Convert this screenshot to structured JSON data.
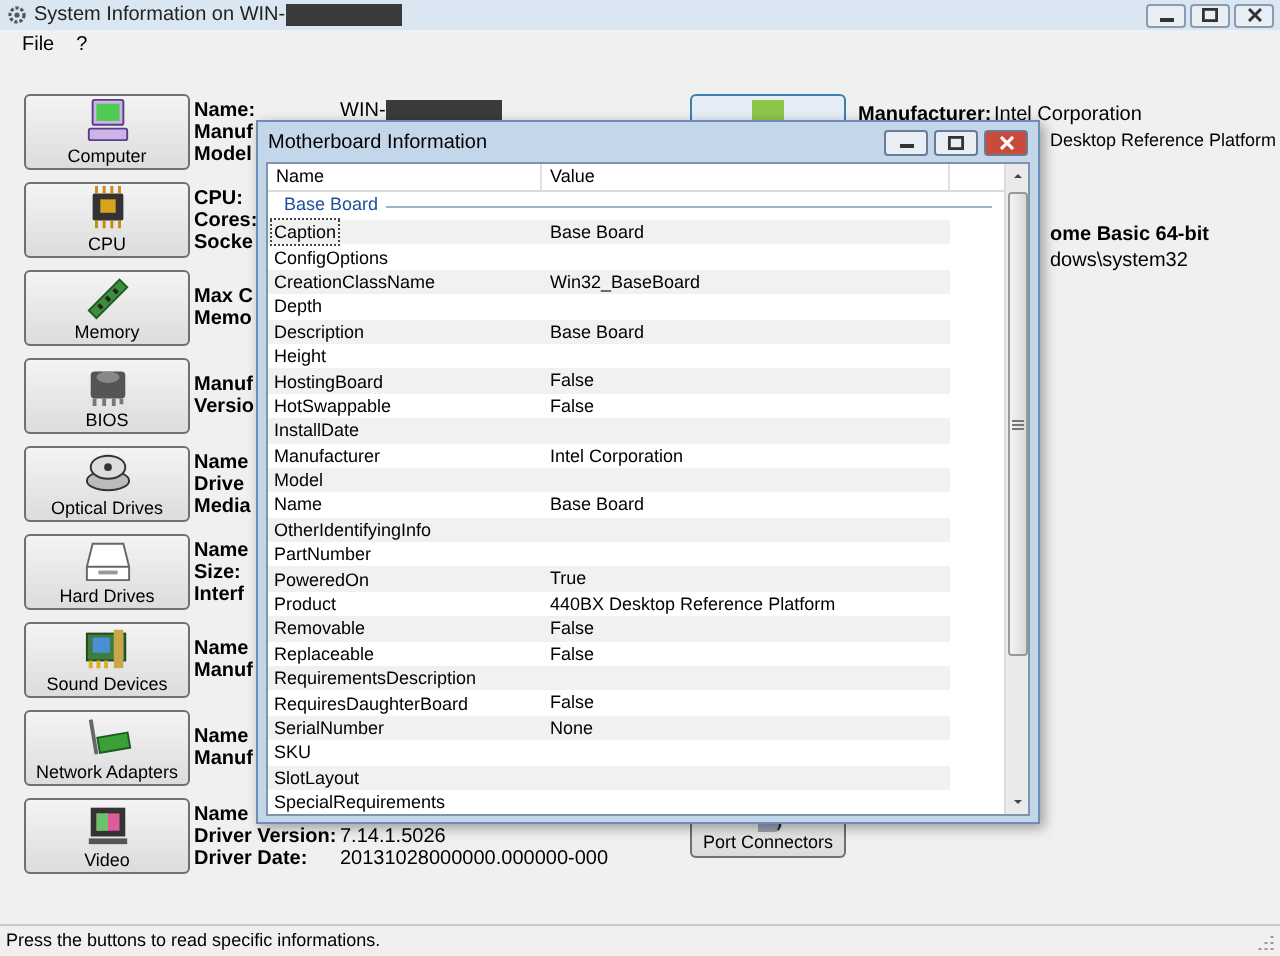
{
  "window": {
    "title": "System Information on WIN-",
    "title_redacted": true
  },
  "menu": [
    "File",
    "?"
  ],
  "categories": [
    {
      "label": "Computer",
      "fields": [
        {
          "label": "Name:",
          "value": "WIN-",
          "redacted": true
        },
        {
          "label": "Manuf"
        },
        {
          "label": "Model"
        }
      ]
    },
    {
      "label": "CPU",
      "fields": [
        {
          "label": "CPU:"
        },
        {
          "label": "Cores:"
        },
        {
          "label": "Socke"
        }
      ]
    },
    {
      "label": "Memory",
      "fields": [
        {
          "label": "Max C"
        },
        {
          "label": "Memo"
        }
      ]
    },
    {
      "label": "BIOS",
      "fields": [
        {
          "label": "Manuf"
        },
        {
          "label": "Versio"
        }
      ]
    },
    {
      "label": "Optical Drives",
      "fields": [
        {
          "label": "Name"
        },
        {
          "label": "Drive"
        },
        {
          "label": "Media"
        }
      ]
    },
    {
      "label": "Hard Drives",
      "fields": [
        {
          "label": "Name"
        },
        {
          "label": "Size:"
        },
        {
          "label": "Interf"
        }
      ]
    },
    {
      "label": "Sound Devices",
      "fields": [
        {
          "label": "Name"
        },
        {
          "label": "Manuf"
        }
      ]
    },
    {
      "label": "Network Adapters",
      "fields": [
        {
          "label": "Name"
        },
        {
          "label": "Manuf"
        }
      ]
    },
    {
      "label": "Video",
      "fields": [
        {
          "label": "Name"
        },
        {
          "label": "Driver Version:",
          "value": "7.14.1.5026"
        },
        {
          "label": "Driver Date:",
          "value": "20131028000000.000000-000"
        }
      ]
    }
  ],
  "middle_buttons": [
    {
      "kind": "motherboard"
    },
    {
      "kind": "ports",
      "label": "Port Connectors"
    }
  ],
  "right_info": {
    "label": "Manufacturer:",
    "value": "Intel Corporation",
    "lines": [
      {
        "text": "Desktop Reference Platform",
        "bold": false
      },
      {
        "text": "ome Basic  64-bit",
        "bold": true
      },
      {
        "text": "dows\\system32",
        "bold": false
      }
    ]
  },
  "dialog": {
    "title": "Motherboard Information",
    "columns": [
      "Name",
      "Value"
    ],
    "group": "Base Board",
    "rows": [
      {
        "name": "Caption",
        "value": "Base Board",
        "focused": true
      },
      {
        "name": "ConfigOptions",
        "focused": false
      },
      {
        "name": "CreationClassName",
        "value": "Win32_BaseBoard",
        "focused": false
      },
      {
        "name": "Depth",
        "focused": false
      },
      {
        "name": "Description",
        "value": "Base Board",
        "focused": false
      },
      {
        "name": "Height",
        "focused": false
      },
      {
        "name": "HostingBoard",
        "value": "False",
        "focused": false
      },
      {
        "name": "HotSwappable",
        "value": "False",
        "focused": false
      },
      {
        "name": "InstallDate",
        "focused": false
      },
      {
        "name": "Manufacturer",
        "value": "Intel Corporation",
        "focused": false
      },
      {
        "name": "Model",
        "focused": false
      },
      {
        "name": "Name",
        "value": "Base Board",
        "focused": false
      },
      {
        "name": "OtherIdentifyingInfo",
        "focused": false
      },
      {
        "name": "PartNumber",
        "focused": false
      },
      {
        "name": "PoweredOn",
        "value": "True",
        "focused": false
      },
      {
        "name": "Product",
        "value": "440BX Desktop Reference Platform",
        "focused": false
      },
      {
        "name": "Removable",
        "value": "False",
        "focused": false
      },
      {
        "name": "Replaceable",
        "value": "False",
        "focused": false
      },
      {
        "name": "RequirementsDescription",
        "focused": false
      },
      {
        "name": "RequiresDaughterBoard",
        "value": "False",
        "focused": false
      },
      {
        "name": "SerialNumber",
        "value": "None",
        "focused": false
      },
      {
        "name": "SKU",
        "focused": false
      },
      {
        "name": "SlotLayout",
        "focused": false
      },
      {
        "name": "SpecialRequirements",
        "focused": false
      }
    ]
  },
  "status_bar": "Press the buttons to read specific informations."
}
